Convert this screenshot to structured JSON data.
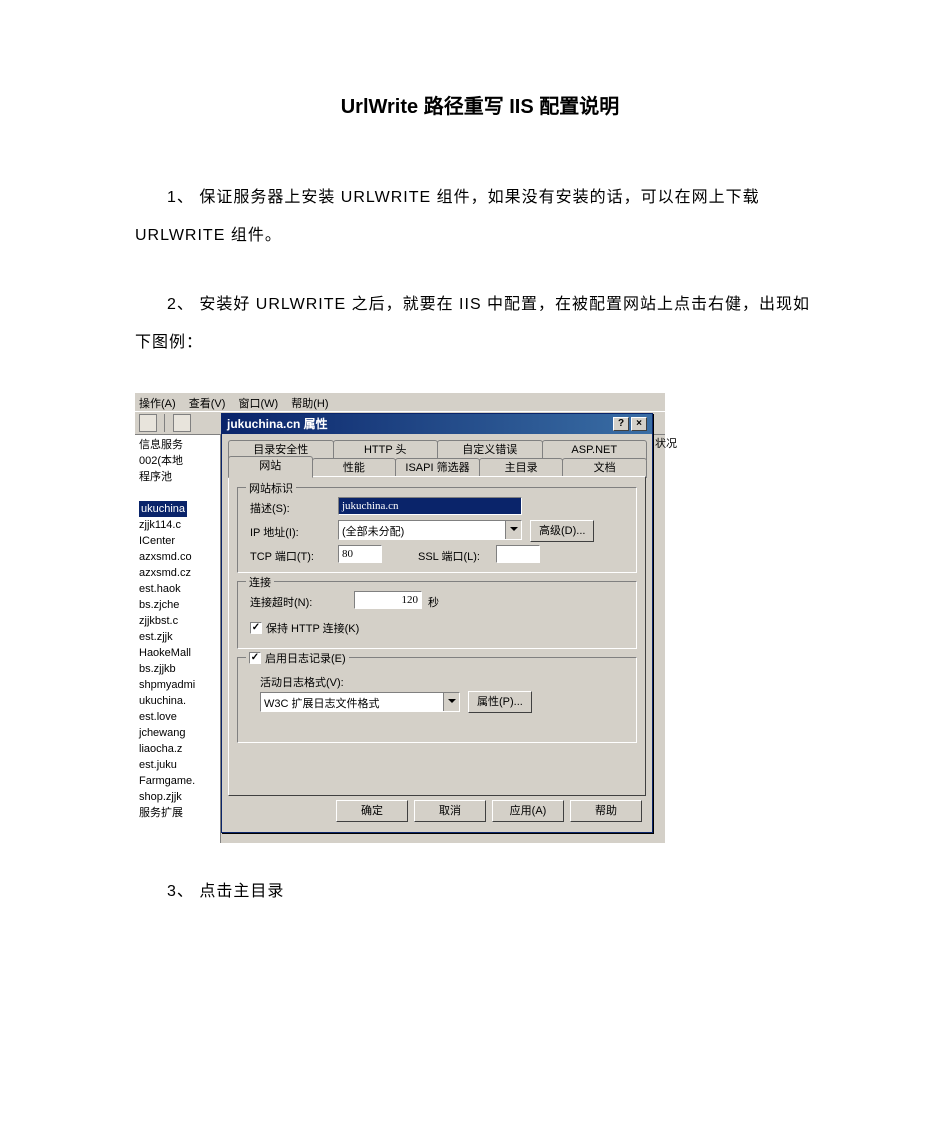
{
  "doc": {
    "title": "UrlWrite 路径重写 IIS 配置说明",
    "para1": "1、  保证服务器上安装 URLWRITE 组件，如果没有安装的话，可以在网上下载 URLWRITE 组件。",
    "para2": "2、  安装好 URLWRITE 之后，就要在 IIS 中配置，在被配置网站上点击右健，出现如下图例：",
    "para3": "3、  点击主目录"
  },
  "menubar": {
    "m1": "操作(A)",
    "m2": "查看(V)",
    "m3": "窗口(W)",
    "m4": "帮助(H)"
  },
  "leftpane": {
    "l0": "信息服务",
    "l1": "002(本地",
    "l2": "程序池",
    "l3": "",
    "l4": "ukuchina",
    "l5": "zjjk114.c",
    "l6": "ICenter",
    "l7": "azxsmd.co",
    "l8": "azxsmd.cz",
    "l9": "est.haok",
    "l10": "bs.zjche",
    "l11": "zjjkbst.c",
    "l12": "est.zjjk",
    "l13": "HaokeMall",
    "l14": "bs.zjjkb",
    "l15": "shpmyadmi",
    "l16": "ukuchina.",
    "l17": "est.love",
    "l18": "jchewang",
    "l19": "liaocha.z",
    "l20": "est.juku",
    "l21": "Farmgame.",
    "l22": "shop.zjjk",
    "l23": "服务扩展"
  },
  "rightcol": "状况",
  "dialog": {
    "title": "jukuchina.cn 属性",
    "help_btn": "?",
    "close_btn": "×",
    "tabs_row1": [
      "目录安全性",
      "HTTP 头",
      "自定义错误",
      "ASP.NET"
    ],
    "tabs_row2": [
      "网站",
      "性能",
      "ISAPI 筛选器",
      "主目录",
      "文档"
    ],
    "group1_legend": "网站标识",
    "desc_label": "描述(S):",
    "desc_value": "jukuchina.cn",
    "ip_label": "IP 地址(I):",
    "ip_value": "(全部未分配)",
    "adv_btn": "高级(D)...",
    "tcp_label": "TCP 端口(T):",
    "tcp_value": "80",
    "ssl_label": "SSL 端口(L):",
    "ssl_value": "",
    "group2_legend": "连接",
    "timeout_label": "连接超时(N):",
    "timeout_value": "120",
    "seconds": "秒",
    "keepalive": "保持 HTTP 连接(K)",
    "group3_chk": "启用日志记录(E)",
    "logfmt_label": "活动日志格式(V):",
    "logfmt_value": "W3C 扩展日志文件格式",
    "props_btn": "属性(P)...",
    "buttons": {
      "ok": "确定",
      "cancel": "取消",
      "apply": "应用(A)",
      "help": "帮助"
    }
  }
}
